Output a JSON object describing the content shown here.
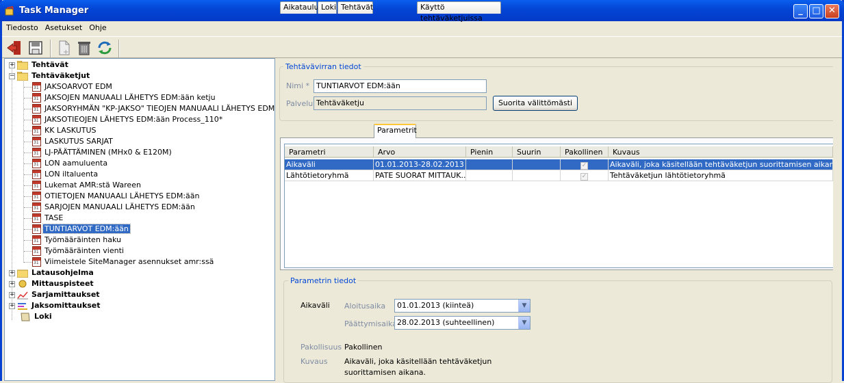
{
  "window": {
    "title": "Task Manager"
  },
  "menu": [
    "Tiedosto",
    "Asetukset",
    "Ohje"
  ],
  "tree": {
    "root_items": [
      {
        "label": "Tehtävät",
        "expanded": false
      },
      {
        "label": "Tehtäväketjut",
        "expanded": true
      }
    ],
    "chains": [
      "JAKSOARVOT EDM",
      "JAKSOJEN MANUAALI LÄHETYS EDM:ään ketju",
      "JAKSORYHMÄN  \"KP-JAKSO\" TIEOJEN  MANUAALI LÄHETYS EDM:ään",
      "JAKSOTIEOJEN  LÄHETYS EDM:ään Process_110*",
      "KK LASKUTUS",
      "LASKUTUS SARJAT",
      "LJ-PÄÄTTÄMINEN (MHx0 & E120M)",
      "LON aamuluenta",
      "LON iltaluenta",
      "Lukemat AMR:stä Wareen",
      "OTIETOJEN  MANUAALI LÄHETYS EDM:ään",
      "SARJOJEN MANUAALI LÄHETYS EDM:ään",
      "TASE",
      "TUNTIARVOT EDM:ään",
      "Työmääräinten haku",
      "Työmääräinten vienti",
      "Viimeistele SiteManager asennukset amr:ssä"
    ],
    "selected": "TUNTIARVOT EDM:ään",
    "bottom_items": [
      "Latausohjelma",
      "Mittauspisteet",
      "Sarjamittaukset",
      "Jaksomittaukset",
      "Loki"
    ]
  },
  "details": {
    "group_title": "Tehtävävirran tiedot",
    "name_label": "Nimi *",
    "name_value": "TUNTIARVOT EDM:ään",
    "service_label": "Palvelu",
    "service_value": "Tehtäväketju",
    "run_button": "Suorita välittömästi"
  },
  "tabs": [
    "Aikataulu",
    "Loki",
    "Tehtävät",
    "Parametrit",
    "Käyttö tehtäväketjuissa"
  ],
  "active_tab": "Parametrit",
  "params_table": {
    "headers": [
      "Parametri",
      "Arvo",
      "Pienin",
      "Suurin",
      "Pakollinen",
      "Kuvaus"
    ],
    "rows": [
      {
        "param": "Aikaväli",
        "value": "01.01.2013-28.02.2013 ...",
        "min": "",
        "max": "",
        "required": true,
        "desc": "Aikaväli, joka käsitellään tehtäväketjun suorittamisen aikana."
      },
      {
        "param": "Lähtötietoryhmä",
        "value": "PATE SUORAT MITTAUK...",
        "min": "",
        "max": "",
        "required": true,
        "desc": "Tehtäväketjun lähtötietoryhmä"
      }
    ]
  },
  "param_details": {
    "group_title": "Parametrin tiedot",
    "name": "Aikaväli",
    "start_label": "Aloitusaika",
    "start_value": "01.01.2013 (kiinteä)",
    "end_label": "Päättymisaika",
    "end_value": "28.02.2013 (suhteellinen)",
    "required_label": "Pakollisuus",
    "required_value": "Pakollinen",
    "desc_label": "Kuvaus",
    "desc_line1": "Aikaväli, joka käsitellään tehtäväketjun",
    "desc_line2": "suorittamisen aikana."
  }
}
